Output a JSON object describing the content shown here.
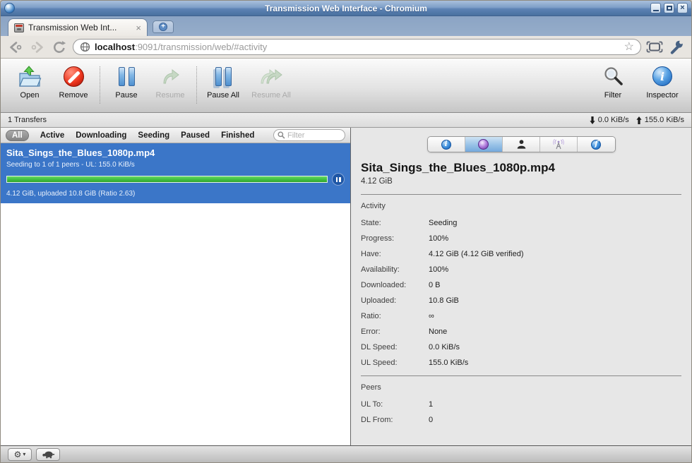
{
  "window": {
    "title": "Transmission Web Interface - Chromium"
  },
  "browser": {
    "tab_title": "Transmission Web Int...",
    "tab_close": "×",
    "url_host": "localhost",
    "url_rest": ":9091/transmission/web/#activity",
    "star": "☆"
  },
  "toolbar": {
    "buttons": [
      {
        "label": "Open",
        "icon": "open-folder-icon",
        "enabled": true
      },
      {
        "label": "Remove",
        "icon": "remove-icon",
        "enabled": true
      },
      {
        "label": "Pause",
        "icon": "pause-icon",
        "enabled": true
      },
      {
        "label": "Resume",
        "icon": "resume-icon",
        "enabled": false
      },
      {
        "label": "Pause All",
        "icon": "pause-all-icon",
        "enabled": true
      },
      {
        "label": "Resume All",
        "icon": "resume-all-icon",
        "enabled": false
      }
    ],
    "filter_label": "Filter",
    "inspector_label": "Inspector"
  },
  "statusbar": {
    "transfers": "1 Transfers",
    "down_speed": "0.0 KiB/s",
    "up_speed": "155.0 KiB/s"
  },
  "filterbar": {
    "tabs": [
      "All",
      "Active",
      "Downloading",
      "Seeding",
      "Paused",
      "Finished"
    ],
    "selected": "All",
    "search_placeholder": "Filter"
  },
  "torrent": {
    "name": "Sita_Sings_the_Blues_1080p.mp4",
    "status": "Seeding to 1 of 1 peers - UL: 155.0 KiB/s",
    "progress_percent": 100,
    "details": "4.12 GiB, uploaded 10.8 GiB (Ratio 2.63)"
  },
  "inspector": {
    "tabs": [
      "info",
      "activity",
      "peers",
      "tracker",
      "files"
    ],
    "selected_tab": "activity",
    "title": "Sita_Sings_the_Blues_1080p.mp4",
    "size": "4.12 GiB",
    "activity": {
      "heading": "Activity",
      "rows": [
        {
          "label": "State:",
          "value": "Seeding"
        },
        {
          "label": "Progress:",
          "value": "100%"
        },
        {
          "label": "Have:",
          "value": "4.12 GiB (4.12 GiB verified)"
        },
        {
          "label": "Availability:",
          "value": "100%"
        },
        {
          "label": "Downloaded:",
          "value": "0 B"
        },
        {
          "label": "Uploaded:",
          "value": "10.8 GiB"
        },
        {
          "label": "Ratio:",
          "value": "∞"
        },
        {
          "label": "Error:",
          "value": "None"
        },
        {
          "label": "DL Speed:",
          "value": "0.0 KiB/s"
        },
        {
          "label": "UL Speed:",
          "value": "155.0 KiB/s"
        }
      ]
    },
    "peers": {
      "heading": "Peers",
      "rows": [
        {
          "label": "UL To:",
          "value": "1"
        },
        {
          "label": "DL From:",
          "value": "0"
        }
      ]
    }
  },
  "footer": {
    "gear": "⚙",
    "caret": "▾"
  }
}
